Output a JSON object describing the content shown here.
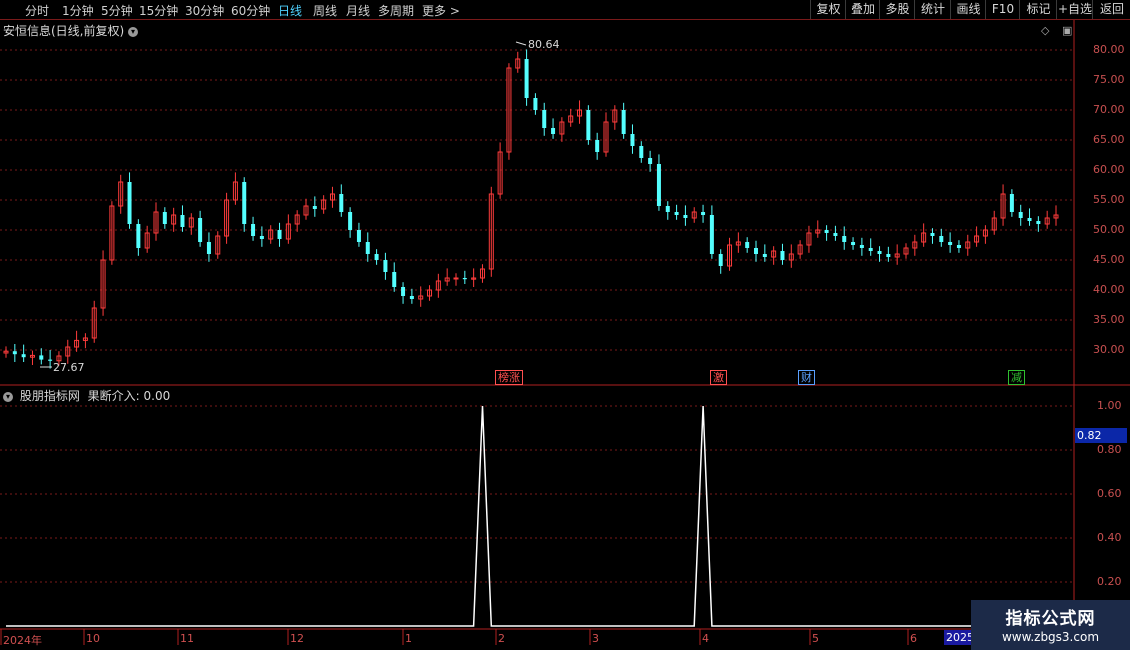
{
  "toolbar": {
    "periods": [
      {
        "label": "分时"
      },
      {
        "label": "1分钟"
      },
      {
        "label": "5分钟"
      },
      {
        "label": "15分钟"
      },
      {
        "label": "30分钟"
      },
      {
        "label": "60分钟"
      },
      {
        "label": "日线",
        "active": true
      },
      {
        "label": "周线"
      },
      {
        "label": "月线"
      },
      {
        "label": "多周期"
      },
      {
        "label": "更多 >"
      }
    ],
    "buttons": [
      {
        "label": "复权"
      },
      {
        "label": "叠加"
      },
      {
        "label": "多股"
      },
      {
        "label": "统计"
      },
      {
        "label": "画线"
      },
      {
        "label": "F10"
      },
      {
        "label": "标记"
      },
      {
        "label": "+自选"
      },
      {
        "label": "返回"
      }
    ]
  },
  "main_panel": {
    "title": "安恒信息(日线,前复权)",
    "high_label": "80.64",
    "low_label": "27.67",
    "y_ticks": [
      "80.00",
      "75.00",
      "70.00",
      "65.00",
      "60.00",
      "55.00",
      "50.00",
      "45.00",
      "40.00",
      "35.00",
      "30.00"
    ],
    "markers": [
      {
        "label": "榜涨",
        "color": "#ff5050"
      },
      {
        "label": "激",
        "color": "#ff5050"
      },
      {
        "label": "财",
        "color": "#5aa0ff"
      },
      {
        "label": "减",
        "color": "#30c030"
      }
    ]
  },
  "indicator_panel": {
    "title": "股朋指标网",
    "value_label": "果断介入: 0.00",
    "y_ticks": [
      "1.00",
      "0.80",
      "0.60",
      "0.40",
      "0.20"
    ],
    "pointer_value": "0.82"
  },
  "date_axis": {
    "labels": [
      "2024年",
      "10",
      "11",
      "12",
      "1",
      "2",
      "3",
      "4",
      "5",
      "6"
    ],
    "highlight": "2025"
  },
  "watermark": {
    "line1": "指标公式网",
    "line2": "www.zbgs3.com"
  },
  "colors": {
    "up": "#ff3c3c",
    "down": "#54ffff",
    "grid": "#7a1a1a",
    "indicator_line": "#ffffff"
  },
  "chart_data": [
    {
      "type": "candlestick",
      "title": "安恒信息(日线,前复权)",
      "ylim": [
        25.0,
        82.0
      ],
      "series": [
        {
          "name": "close",
          "values": [
            29.8,
            29.3,
            28.8,
            29.1,
            28.4,
            28.2,
            29.0,
            30.5,
            31.6,
            32.0,
            37.0,
            45.0,
            54.0,
            58.0,
            51.0,
            47.0,
            49.5,
            53.0,
            51.0,
            52.5,
            50.5,
            52.0,
            48.0,
            46.0,
            49.0,
            55.0,
            58.0,
            51.0,
            49.0,
            48.5,
            50.0,
            48.5,
            51.0,
            52.5,
            54.0,
            53.5,
            55.0,
            56.0,
            53.0,
            50.0,
            48.0,
            46.0,
            45.0,
            43.0,
            40.5,
            39.0,
            38.5,
            39.0,
            40.0,
            41.5,
            42.0,
            42.0,
            41.8,
            42.0,
            43.5,
            56.0,
            63.0,
            77.0,
            78.5,
            72.0,
            70.0,
            67.0,
            66.0,
            68.0,
            69.0,
            70.0,
            65.0,
            63.0,
            68.0,
            70.0,
            66.0,
            64.0,
            62.0,
            61.0,
            54.0,
            53.0,
            52.5,
            52.0,
            53.0,
            52.5,
            46.0,
            44.0,
            47.5,
            48.0,
            47.0,
            46.0,
            45.5,
            46.5,
            45.0,
            46.0,
            47.5,
            49.5,
            50.0,
            49.5,
            49.0,
            48.0,
            47.5,
            47.0,
            46.5,
            46.0,
            45.5,
            46.0,
            47.0,
            48.0,
            49.5,
            49.0,
            48.0,
            47.5,
            47.0,
            48.0,
            49.0,
            50.0,
            52.0,
            56.0,
            53.0,
            52.0,
            51.5,
            51.0,
            52.0,
            52.5
          ]
        }
      ]
    },
    {
      "type": "line",
      "title": "股朋指标网",
      "ylim": [
        0.0,
        1.0
      ],
      "series": [
        {
          "name": "果断介入",
          "values": [
            0,
            0,
            0,
            0,
            0,
            0,
            0,
            0,
            0,
            0,
            0,
            0,
            0,
            0,
            0,
            0,
            0,
            0,
            0,
            0,
            0,
            0,
            0,
            0,
            0,
            0,
            0,
            0,
            0,
            0,
            0,
            0,
            0,
            0,
            0,
            0,
            0,
            0,
            0,
            0,
            0,
            0,
            0,
            0,
            0,
            0,
            0,
            0,
            0,
            0,
            0,
            0,
            0,
            0,
            1,
            0,
            0,
            0,
            0,
            0,
            0,
            0,
            0,
            0,
            0,
            0,
            0,
            0,
            0,
            0,
            0,
            0,
            0,
            0,
            0,
            0,
            0,
            0,
            0,
            1,
            0,
            0,
            0,
            0,
            0,
            0,
            0,
            0,
            0,
            0,
            0,
            0,
            0,
            0,
            0,
            0,
            0,
            0,
            0,
            0,
            0,
            0,
            0,
            0,
            0,
            0,
            0,
            0,
            0,
            0,
            0,
            0,
            0,
            0,
            0,
            0,
            0,
            0,
            0,
            0
          ]
        }
      ]
    }
  ]
}
